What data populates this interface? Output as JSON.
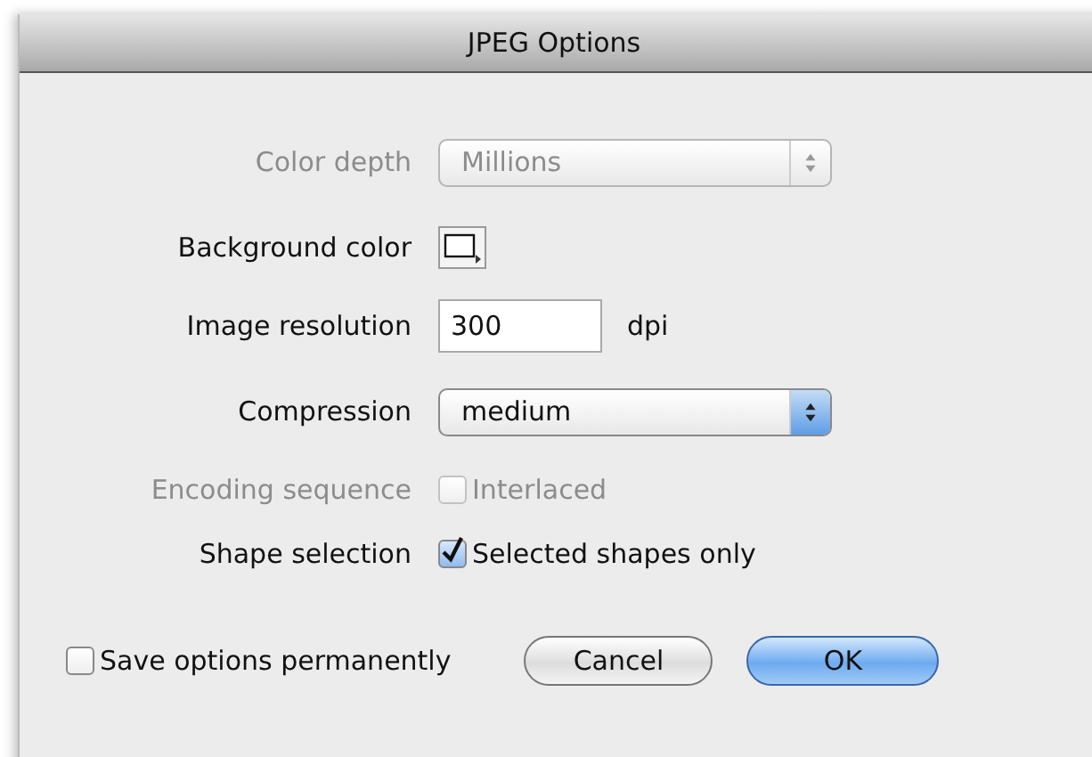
{
  "window": {
    "title": "JPEG Options"
  },
  "fields": [
    {
      "kind": "popup",
      "label": "Color depth",
      "value": "Millions",
      "disabled": true,
      "focused": false
    },
    {
      "kind": "color",
      "label": "Background color",
      "disabled": false
    },
    {
      "kind": "text",
      "label": "Image resolution",
      "value": "300",
      "unit": "dpi",
      "disabled": false
    },
    {
      "kind": "popup",
      "label": "Compression",
      "value": "medium",
      "disabled": false,
      "focused": true
    },
    {
      "kind": "checkbox",
      "label": "Encoding sequence",
      "option": "Interlaced",
      "checked": false,
      "disabled": true
    },
    {
      "kind": "checkbox",
      "label": "Shape selection",
      "option": "Selected shapes only",
      "checked": true,
      "disabled": false
    }
  ],
  "save_option": {
    "label": "Save options permanently",
    "checked": false
  },
  "buttons": [
    {
      "label": "Cancel",
      "default": false
    },
    {
      "label": "OK",
      "default": true
    }
  ]
}
